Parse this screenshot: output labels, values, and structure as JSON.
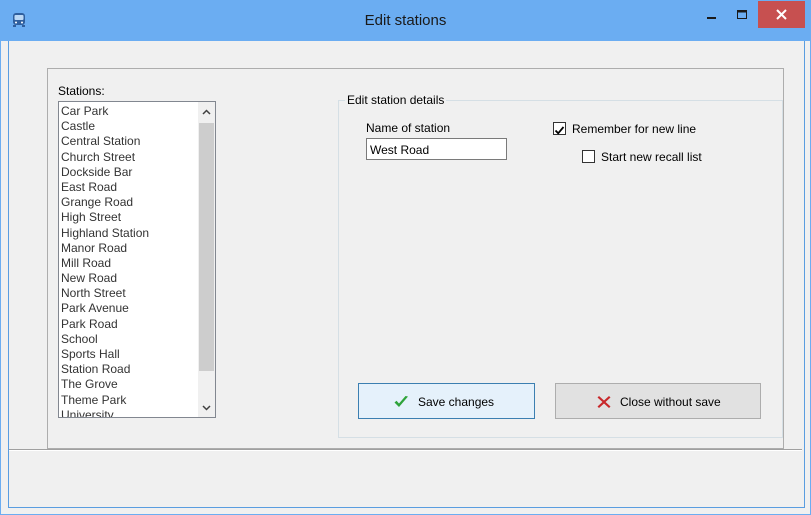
{
  "window": {
    "title": "Edit stations",
    "controls": {
      "minimize": "minimize",
      "maximize": "maximize",
      "close": "close"
    },
    "accent_color": "#6badf2",
    "close_color": "#c75050"
  },
  "stations_panel": {
    "label": "Stations:",
    "items": [
      "Car Park",
      "Castle",
      "Central Station",
      "Church Street",
      "Dockside Bar",
      "East Road",
      "Grange Road",
      "High Street",
      "Highland Station",
      "Manor Road",
      "Mill Road",
      "New Road",
      "North Street",
      "Park Avenue",
      "Park Road",
      "School",
      "Sports Hall",
      "Station Road",
      "The Grove",
      "Theme Park",
      "University"
    ]
  },
  "details": {
    "group_label": "Edit station details",
    "name_label": "Name of station",
    "name_value": "West Road",
    "remember_label": "Remember for new line",
    "remember_checked": true,
    "recall_label": "Start new recall list",
    "recall_checked": false
  },
  "buttons": {
    "save_label": "Save changes",
    "save_icon": "green-checkmark-icon",
    "close_label": "Close without save",
    "close_icon": "red-x-icon"
  }
}
